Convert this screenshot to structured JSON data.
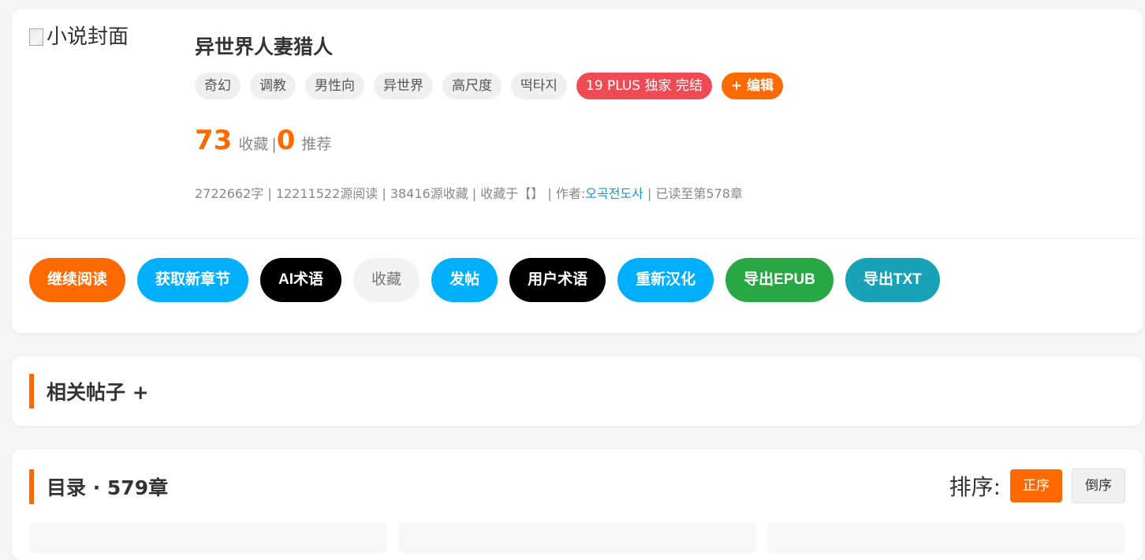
{
  "book": {
    "cover_alt": "小说封面",
    "title": "异世界人妻猎人",
    "tags": [
      "奇幻",
      "调教",
      "男性向",
      "异世界",
      "高尺度",
      "떡타지"
    ],
    "plus_tag": "19 PLUS 独家 完结",
    "edit_tag": "+ 编辑",
    "favorites_count": "73",
    "favorites_label": "收藏",
    "separator": "|",
    "recommend_count": "0",
    "recommend_label": "推荐",
    "meta_prefix": "2722662字 | 12211522源阅读 | 38416源收藏 | 收藏于【】 | 作者:",
    "author": "오곡전도사",
    "meta_suffix": " | 已读至第578章"
  },
  "actions": {
    "continue": "继续阅读",
    "fetch": "获取新章节",
    "ai_terms": "AI术语",
    "favorite": "收藏",
    "post": "发帖",
    "user_terms": "用户术语",
    "retranslate": "重新汉化",
    "export_epub": "导出EPUB",
    "export_txt": "导出TXT"
  },
  "posts": {
    "title": "相关帖子 +"
  },
  "toc": {
    "title": "目录 · 579章",
    "sort_label": "排序:",
    "asc": "正序",
    "desc": "倒序"
  },
  "colors": {
    "accent": "#ff6a00",
    "blue": "#00b0ff",
    "green": "#28a745",
    "teal": "#17a2b8",
    "plus_red": "#f04b55",
    "author_link": "#1296db"
  }
}
